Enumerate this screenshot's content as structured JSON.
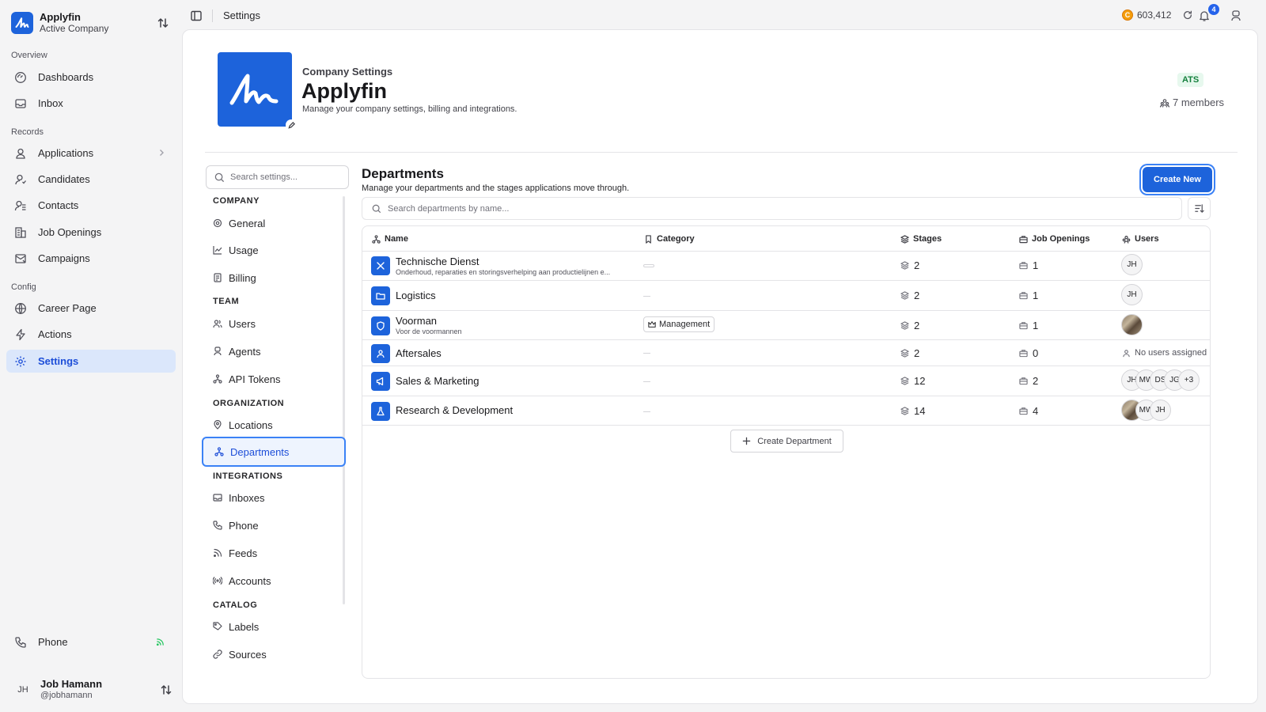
{
  "workspace": {
    "name": "Applyfin",
    "subtitle": "Active Company"
  },
  "sidebar": {
    "sections": [
      {
        "label": "Overview",
        "items": [
          {
            "label": "Dashboards",
            "icon": "dashboard-icon"
          },
          {
            "label": "Inbox",
            "icon": "inbox-icon"
          }
        ]
      },
      {
        "label": "Records",
        "items": [
          {
            "label": "Applications",
            "icon": "applications-icon"
          },
          {
            "label": "Candidates",
            "icon": "candidates-icon"
          },
          {
            "label": "Contacts",
            "icon": "contacts-icon"
          },
          {
            "label": "Job Openings",
            "icon": "job-openings-icon"
          },
          {
            "label": "Campaigns",
            "icon": "campaigns-icon"
          }
        ]
      },
      {
        "label": "Config",
        "items": [
          {
            "label": "Career Page",
            "icon": "career-page-icon"
          },
          {
            "label": "Actions",
            "icon": "actions-icon"
          },
          {
            "label": "Settings",
            "icon": "settings-icon",
            "active": true
          }
        ]
      }
    ],
    "phone_label": "Phone",
    "user": {
      "initials": "JH",
      "name": "Job Hamann",
      "handle": "@jobhamann"
    }
  },
  "topbar": {
    "title": "Settings",
    "credits": "603,412",
    "coin_symbol": "C",
    "notification_count": "4"
  },
  "company": {
    "section_label": "Company Settings",
    "name": "Applyfin",
    "description": "Manage your company settings, billing and integrations.",
    "badge": "ATS",
    "members": "7 members"
  },
  "settings_nav": {
    "search_placeholder": "Search settings...",
    "groups": [
      {
        "label": "COMPANY",
        "items": [
          "General",
          "Usage",
          "Billing"
        ]
      },
      {
        "label": "TEAM",
        "items": [
          "Users",
          "Agents",
          "API Tokens"
        ]
      },
      {
        "label": "ORGANIZATION",
        "items": [
          "Locations",
          "Departments"
        ]
      },
      {
        "label": "INTEGRATIONS",
        "items": [
          "Inboxes",
          "Phone",
          "Feeds",
          "Accounts"
        ]
      },
      {
        "label": "CATALOG",
        "items": [
          "Labels",
          "Sources"
        ]
      }
    ],
    "active": "Departments"
  },
  "departments": {
    "title": "Departments",
    "description": "Manage your departments and the stages applications move through.",
    "create_button": "Create New",
    "search_placeholder": "Search departments by name...",
    "columns": [
      "Name",
      "Category",
      "Stages",
      "Job Openings",
      "Users"
    ],
    "rows": [
      {
        "name": "Technische Dienst",
        "subtitle": "Onderhoud, reparaties en storingsverhelping aan productielijnen e...",
        "category": "",
        "stages": "2",
        "job_openings": "1",
        "users": [
          "JH"
        ]
      },
      {
        "name": "Logistics",
        "subtitle": "",
        "category": "—",
        "stages": "2",
        "job_openings": "1",
        "users": [
          "JH"
        ]
      },
      {
        "name": "Voorman",
        "subtitle": "Voor de voormannen",
        "category": "Management",
        "stages": "2",
        "job_openings": "1",
        "users": [
          "photo"
        ]
      },
      {
        "name": "Aftersales",
        "subtitle": "",
        "category": "—",
        "stages": "2",
        "job_openings": "0",
        "users": [],
        "no_users_text": "No users assigned"
      },
      {
        "name": "Sales & Marketing",
        "subtitle": "",
        "category": "—",
        "stages": "12",
        "job_openings": "2",
        "users": [
          "JH",
          "MW",
          "DS",
          "JG"
        ],
        "more": "+3"
      },
      {
        "name": "Research & Development",
        "subtitle": "",
        "category": "—",
        "stages": "14",
        "job_openings": "4",
        "users": [
          "photo",
          "MW",
          "JH"
        ]
      }
    ],
    "create_department": "Create Department"
  }
}
